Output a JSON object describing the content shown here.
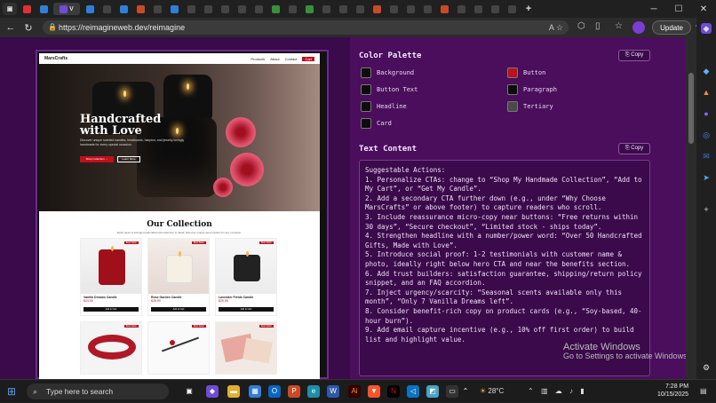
{
  "browser": {
    "url": "https://reimagineweb.dev/reimagine",
    "update_label": "Update",
    "tabs": [
      "Y",
      "G",
      "V",
      "S",
      "F",
      "D",
      "F",
      "M",
      "S",
      "M",
      "a",
      "M",
      "M",
      "M",
      "M",
      "M",
      "M",
      "V",
      "M",
      "S",
      "M",
      "M",
      "M",
      "M",
      "M",
      "R",
      "M",
      "M",
      "M"
    ],
    "active_tab_label": "V"
  },
  "preview": {
    "brand": "MarsCrafts",
    "nav_links": [
      "Products",
      "About",
      "Contact"
    ],
    "cart_label": "Cart",
    "hero_title_line1": "Handcrafted",
    "hero_title_line2": "with Love",
    "hero_text": "Discover unique scented candles, headbands, hairpins, and jewelry lovingly handmade for every special occasion.",
    "hero_primary_btn": "Shop Collection →",
    "hero_secondary_btn": "Learn More",
    "collection_title": "Our Collection",
    "collection_sub": "Each piece is lovingly handcrafted with attention to detail. Discover unique items perfect for any occasion.",
    "products": [
      {
        "name": "Vanilla Dreams Candle",
        "price": "$24.99",
        "badge": "Best Seller",
        "btn": "Add to Cart"
      },
      {
        "name": "Rose Garden Candle",
        "price": "$26.99",
        "badge": "Best Seller",
        "btn": "Add to Cart"
      },
      {
        "name": "Lavender Fields Candle",
        "price": "$25.99",
        "badge": "Best Seller",
        "btn": "Add to Cart"
      }
    ],
    "products_row2_badges": [
      "Best Seller",
      "Best Seller",
      "Best Seller"
    ]
  },
  "panel": {
    "palette_title": "Color Palette",
    "copy_label": "Copy",
    "swatches": [
      {
        "label": "Background",
        "color": "#0d0d0d"
      },
      {
        "label": "Button",
        "color": "#c0101a"
      },
      {
        "label": "Button Text",
        "color": "#0d0d0d"
      },
      {
        "label": "Paragraph",
        "color": "#0d0d0d"
      },
      {
        "label": "Headline",
        "color": "#0d0d0d"
      },
      {
        "label": "Tertiary",
        "color": "#4a4a4a"
      },
      {
        "label": "Card",
        "color": "#0d0d0d"
      }
    ],
    "text_title": "Text Content",
    "text_copy_label": "Copy",
    "text_body": "Suggestable Actions:\n1. Personalize CTAs: change to “Shop My Handmade Collection”, “Add to My Cart”, or “Get My Candle”.\n2. Add a secondary CTA further down (e.g., under “Why Choose MarsCrafts” or above footer) to capture readers who scroll.\n3. Include reassurance micro-copy near buttons: “Free returns within 30 days”, “Secure checkout”, “Limited stock - ships today”.\n4. Strengthen headline with a number/power word: “Over 50 Handcrafted Gifts, Made with Love”.\n5. Introduce social proof: 1-2 testimonials with customer name & photo, ideally right below hero CTA and near the benefits section.\n6. Add trust builders: satisfaction guarantee, shipping/return policy snippet, and an FAQ accordion.\n7. Inject urgency/scarcity: “Seasonal scents available only this month”, “Only 7 Vanilla Dreams left”.\n8. Consider benefit-rich copy on product cards (e.g., “Soy-based, 40-hour burn”).\n9. Add email capture incentive (e.g., 10% off first order) to build list and highlight value."
  },
  "watermark": {
    "line1": "Activate Windows",
    "line2": "Go to Settings to activate Windows."
  },
  "taskbar": {
    "search_placeholder": "Type here to search",
    "weather": "28°C",
    "time": "7:28 PM",
    "date": "10/15/2025"
  }
}
